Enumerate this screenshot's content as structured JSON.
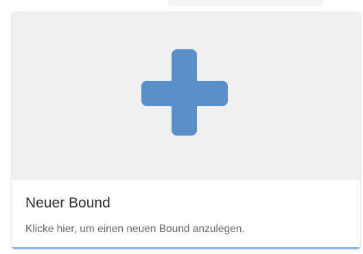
{
  "card": {
    "title": "Neuer Bound",
    "description": "Klicke hier, um einen neuen Bound anzulegen.",
    "icon": "plus-icon"
  },
  "colors": {
    "icon": "#5b8fca",
    "accent": "#8bb7e6",
    "media_background": "#f0f0f0"
  }
}
